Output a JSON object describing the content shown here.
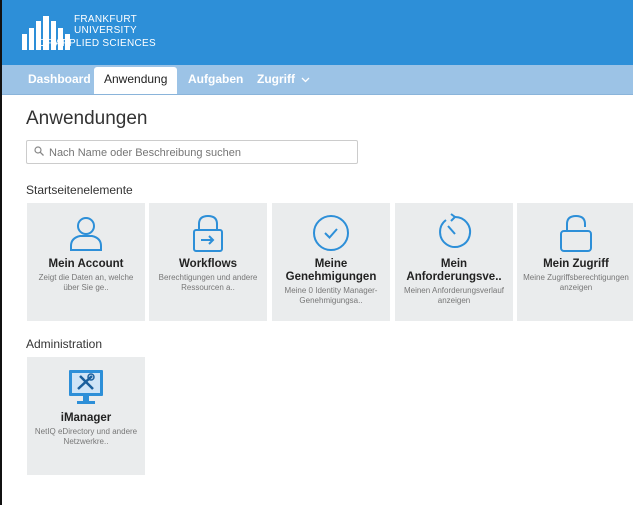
{
  "brand": {
    "line1": "FRANKFURT",
    "line2": "UNIVERSITY",
    "line3": "OF APPLIED SCIENCES",
    "bar_color": "#2d8fd8"
  },
  "nav": {
    "tabs": [
      {
        "label": "Dashboard",
        "active": false
      },
      {
        "label": "Anwendung",
        "active": true
      },
      {
        "label": "Aufgaben",
        "active": false
      },
      {
        "label": "Zugriff",
        "active": false,
        "dropdown": true
      }
    ]
  },
  "main": {
    "title": "Anwendungen",
    "search": {
      "placeholder": "Nach Name oder Beschreibung suchen",
      "value": ""
    }
  },
  "sections": [
    {
      "title": "Startseitenelemente",
      "cards": [
        {
          "icon": "user-icon",
          "title": "Mein Account",
          "desc": "Zeigt die Daten an, welche über Sie ge.."
        },
        {
          "icon": "workflow-lock-icon",
          "title": "Workflows",
          "desc": "Berechtigungen und andere Ressourcen a.."
        },
        {
          "icon": "check-circle-icon",
          "title": "Meine Genehmigungen",
          "desc": "Meine 0 Identity Manager-Genehmigungsa.."
        },
        {
          "icon": "history-icon",
          "title": "Mein Anforderungsve..",
          "desc": "Meinen Anforderungsverlauf anzeigen"
        },
        {
          "icon": "lock-icon",
          "title": "Mein Zugriff",
          "desc": "Meine Zugriffsberechtigungen anzeigen"
        }
      ]
    },
    {
      "title": "Administration",
      "cards": [
        {
          "icon": "imanager-tools-icon",
          "title": "iManager",
          "desc": "NetIQ eDirectory und andere Netzwerkre.."
        }
      ]
    }
  ]
}
